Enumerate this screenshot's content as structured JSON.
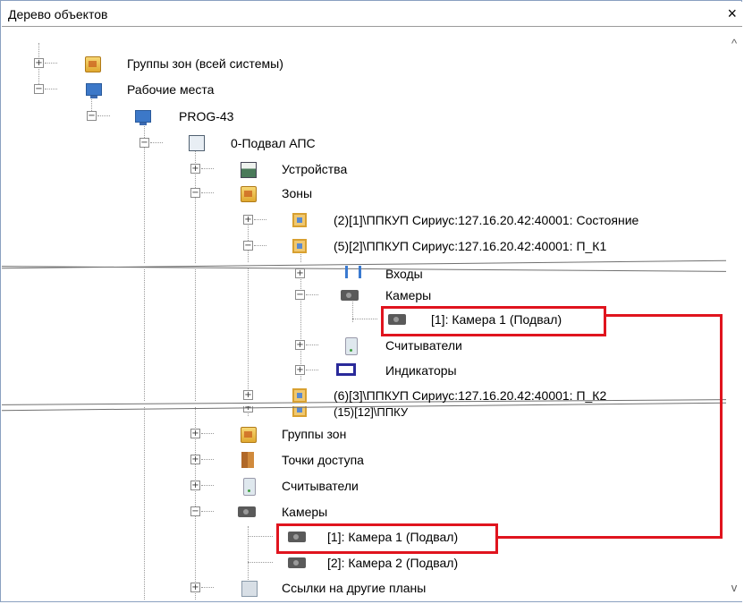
{
  "window": {
    "title": "Дерево объектов",
    "close_glyph": "×"
  },
  "tree": {
    "zone_groups_all": "Группы зон (всей системы)",
    "workstations": "Рабочие места",
    "prog43": "PROG-43",
    "basement_aps": "0-Подвал АПС",
    "devices": "Устройства",
    "zones": "Зоны",
    "zone_2": "(2)[1]\\ППКУП Сириус:127.16.20.42:40001: Состояние",
    "zone_5": "(5)[2]\\ППКУП Сириус:127.16.20.42:40001: П_К1",
    "inputs": "Входы",
    "cameras_inner": "Камеры",
    "camera1_inner": "[1]: Камера 1 (Подвал)",
    "readers_inner": "Считыватели",
    "indicators": "Индикаторы",
    "zone_6": "(6)[3]\\ППКУП Сириус:127.16.20.42:40001: П_К2",
    "zone_15": "(15)[12]\\ППКУ",
    "zone_groups": "Группы зон",
    "access_points": "Точки доступа",
    "readers": "Считыватели",
    "cameras": "Камеры",
    "camera1": "[1]: Камера 1 (Подвал)",
    "camera2": "[2]: Камера 2 (Подвал)",
    "links_other_plans": "Ссылки на другие планы"
  },
  "scroll": {
    "up_glyph": "^",
    "down_glyph": "v"
  },
  "colors": {
    "highlight": "#e0141e",
    "folder_icon": "#3c78c8"
  }
}
